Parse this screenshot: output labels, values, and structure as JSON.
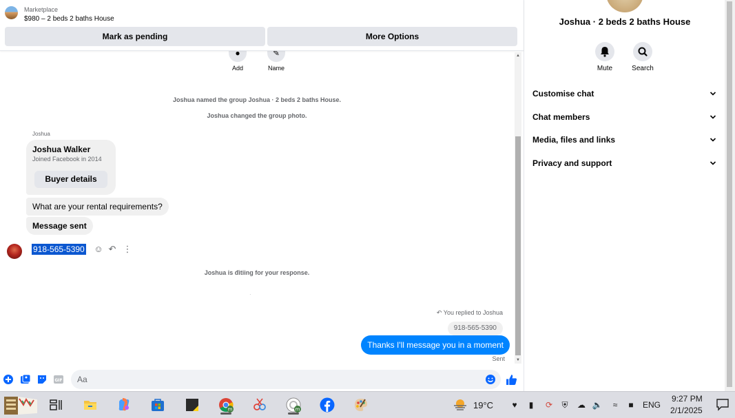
{
  "header": {
    "marketplace_label": "Marketplace",
    "listing_title": "$980 – 2 beds 2 baths House",
    "mark_pending_label": "Mark as pending",
    "more_options_label": "More Options"
  },
  "top_actions": {
    "add_label": "Add",
    "name_label": "Name"
  },
  "system_messages": {
    "named_group": "Joshua named the group Joshua · 2 beds 2 baths House.",
    "changed_photo": "Joshua changed the group photo.",
    "waiting": "Joshua is ᵭitiing for your response."
  },
  "conversation": {
    "sender_name": "Joshua",
    "contact_card": {
      "name": "Joshua Walker",
      "subtitle": "Joined Facebook in 2014",
      "button_label": "Buyer details"
    },
    "incoming_messages": [
      "What are your rental requirements?",
      "Message sent"
    ],
    "own_phone_message": "918-565-5390",
    "reply_indicator": "You replied to Joshua",
    "quoted_text": "918-565-5390",
    "outgoing_message": "Thanks I'll message you in a moment",
    "status": "Sent"
  },
  "composer": {
    "placeholder": "Aa"
  },
  "info_panel": {
    "title": "Joshua · 2 beds 2 baths House",
    "mute_label": "Mute",
    "search_label": "Search",
    "sections": [
      "Customise chat",
      "Chat members",
      "Media, files and links",
      "Privacy and support"
    ]
  },
  "taskbar": {
    "apps": [
      "file-explorer-icon",
      "microsoft-store-icon",
      "sticky-notes-icon",
      "chrome-icon",
      "snipping-tool-icon",
      "chrome-profile-icon",
      "facebook-icon",
      "paint-icon"
    ],
    "weather": "19°C",
    "language": "ENG",
    "time": "9:27 PM",
    "date": "2/1/2025"
  },
  "colors": {
    "messenger_blue": "#0084ff",
    "accent_blue": "#0866ff",
    "selection_blue": "#0b57d0",
    "bubble_gray": "#f0f0f0"
  }
}
